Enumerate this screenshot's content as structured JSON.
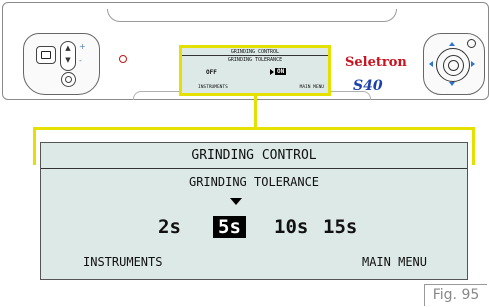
{
  "device": {
    "brand_logo": "Seletron",
    "model": "S40",
    "rocker_plus": "+",
    "rocker_minus": "-"
  },
  "mini_screen": {
    "title": "GRINDING CONTROL",
    "subtitle": "GRINDING TOLERANCE",
    "off_label": "OFF",
    "on_label": "ON",
    "left_softkey": "INSTRUMENTS",
    "right_softkey": "MAIN MENU"
  },
  "screen": {
    "title": "GRINDING CONTROL",
    "subtitle": "GRINDING TOLERANCE",
    "options": [
      {
        "label": "2s",
        "selected": false
      },
      {
        "label": "5s",
        "selected": true
      },
      {
        "label": "10s",
        "selected": false
      },
      {
        "label": "15s",
        "selected": false
      }
    ],
    "left_softkey": "INSTRUMENTS",
    "right_softkey": "MAIN MENU"
  },
  "figure_label": "Fig. 95",
  "colors": {
    "screen_bg": "#dce9e6",
    "callout": "#e4e000",
    "logo_red": "#c8141e",
    "model_blue": "#1a3fb0",
    "arrow_blue": "#2f73d0"
  }
}
